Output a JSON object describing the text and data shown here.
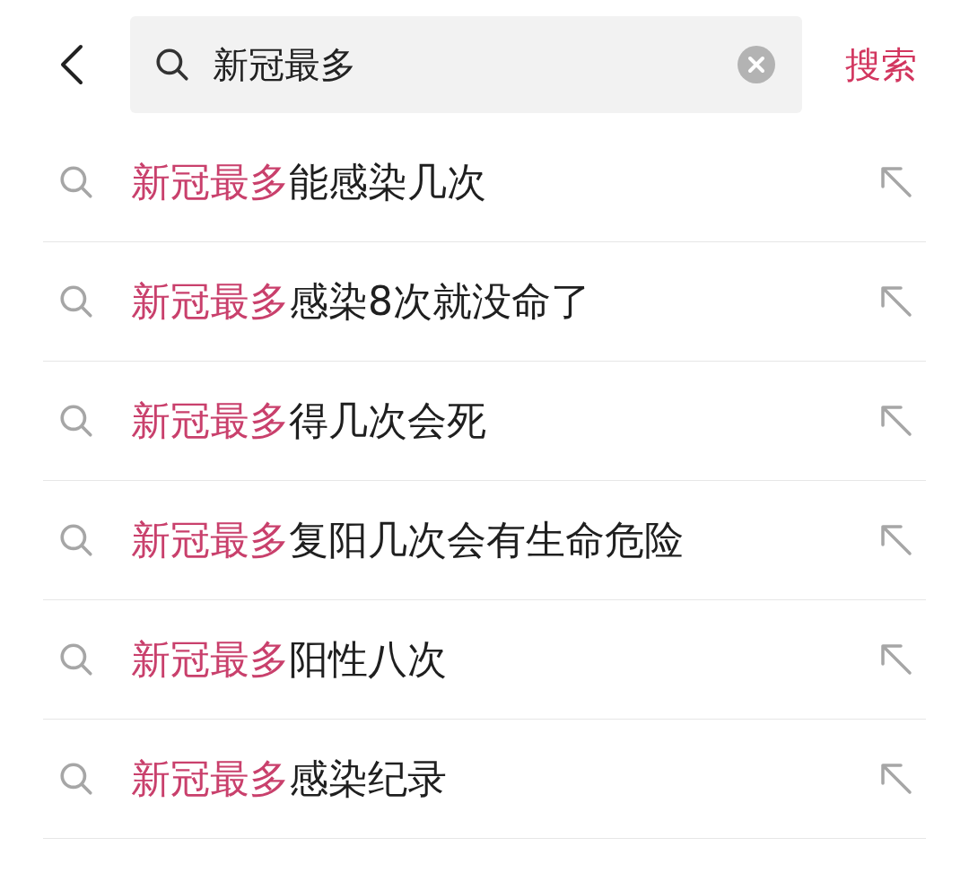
{
  "search": {
    "value": "新冠最多",
    "submit": "搜索"
  },
  "suggestions": [
    {
      "match": "新冠最多",
      "rest": "能感染几次"
    },
    {
      "match": "新冠最多",
      "rest": "感染8次就没命了"
    },
    {
      "match": "新冠最多",
      "rest": "得几次会死"
    },
    {
      "match": "新冠最多",
      "rest": "复阳几次会有生命危险"
    },
    {
      "match": "新冠最多",
      "rest": "阳性八次"
    },
    {
      "match": "新冠最多",
      "rest": "感染纪录"
    }
  ]
}
